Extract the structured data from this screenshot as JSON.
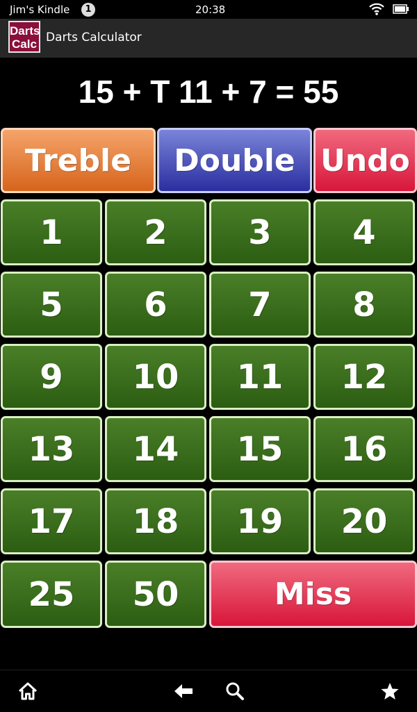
{
  "status_bar": {
    "device_name": "Jim's Kindle",
    "notification_count": "1",
    "time": "20:38",
    "icons": [
      "wifi-icon",
      "battery-icon"
    ]
  },
  "title_bar": {
    "app_icon_line1": "Darts",
    "app_icon_line2": "Calc",
    "title": "Darts Calculator"
  },
  "equation": "15 + T 11 + 7 = 55",
  "modifiers": {
    "treble": "Treble",
    "double": "Double",
    "undo": "Undo"
  },
  "numbers": [
    "1",
    "2",
    "3",
    "4",
    "5",
    "6",
    "7",
    "8",
    "9",
    "10",
    "11",
    "12",
    "13",
    "14",
    "15",
    "16",
    "17",
    "18",
    "19",
    "20",
    "25",
    "50"
  ],
  "miss": "Miss",
  "nav_bar": {
    "icons": [
      "home-icon",
      "back-icon",
      "search-icon",
      "favorites-icon"
    ]
  },
  "colors": {
    "number_button": "#3d6f1f",
    "treble_button": "#e8843f",
    "double_button": "#3d43b2",
    "undo_button": "#e22a4b",
    "miss_button": "#e22a4b"
  }
}
